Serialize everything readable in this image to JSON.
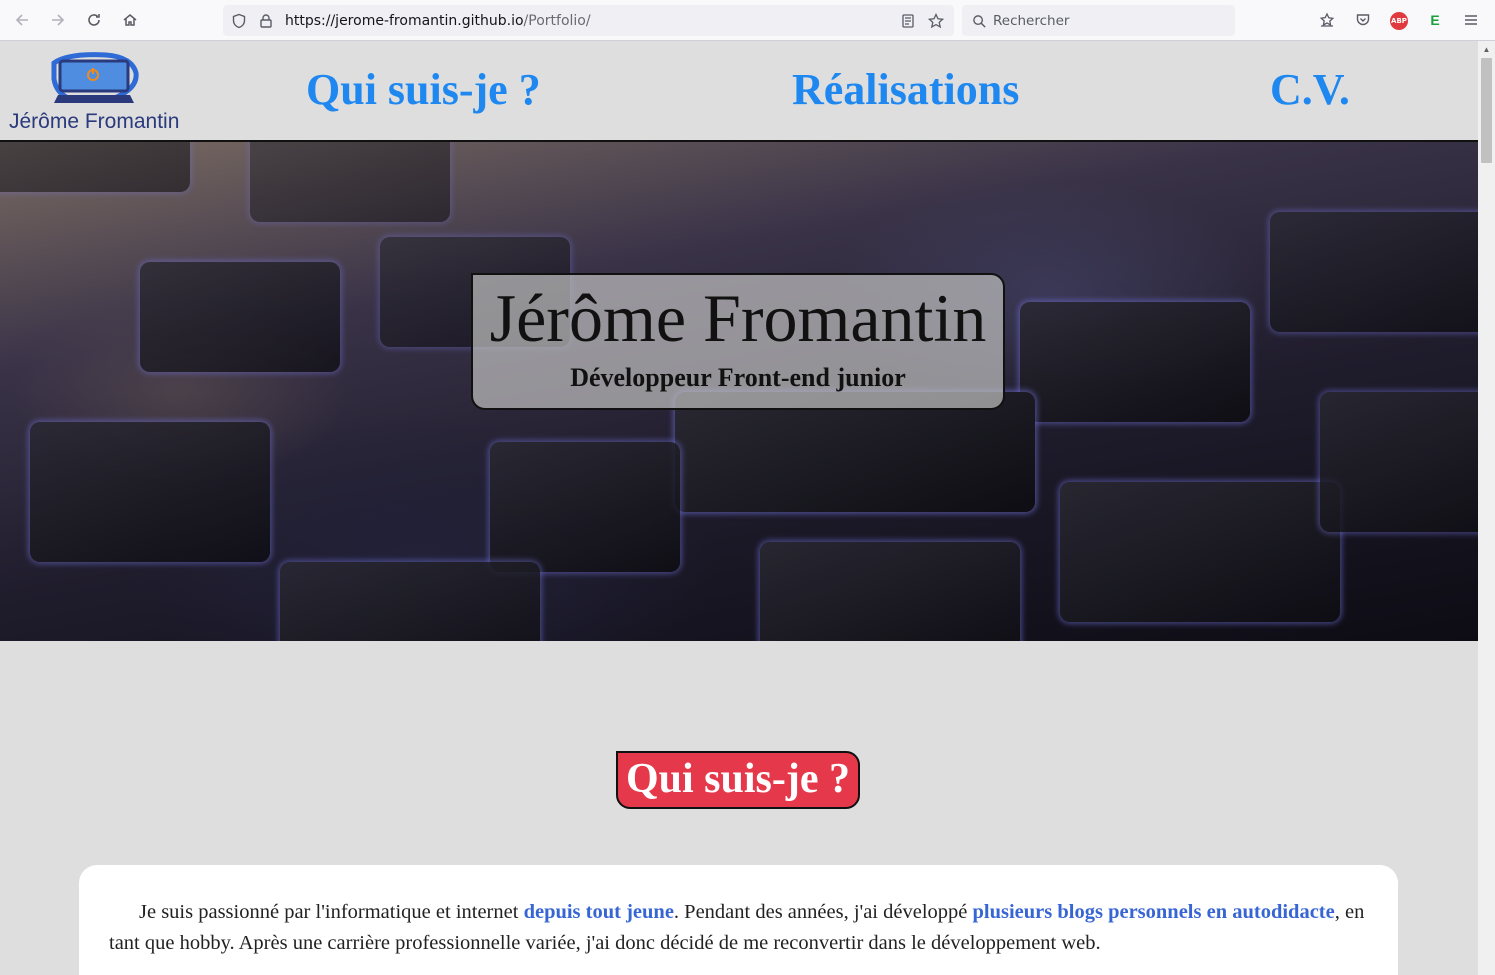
{
  "browser": {
    "url_domain": "https://jerome-fromantin.github.io",
    "url_path": "/Portfolio/",
    "search_placeholder": "Rechercher",
    "extensions": {
      "abp_label": "ABP",
      "e_label": "E"
    },
    "icons": [
      "back-arrow-icon",
      "forward-arrow-icon",
      "reload-icon",
      "home-icon",
      "shield-icon",
      "lock-icon",
      "reader-view-icon",
      "bookmark-star-icon",
      "search-icon",
      "library-icon",
      "pocket-icon",
      "menu-icon"
    ]
  },
  "site": {
    "logo_text": "Jérôme Fromantin",
    "nav": [
      {
        "label": "Qui suis-je ?"
      },
      {
        "label": "Réalisations"
      },
      {
        "label": "C.V."
      }
    ],
    "hero": {
      "title": "Jérôme Fromantin",
      "subtitle": "Développeur Front-end junior"
    },
    "section": {
      "title": "Qui suis-je ?",
      "paragraph": {
        "t1": "Je suis passionné par l'informatique et internet ",
        "h1": "depuis tout jeune",
        "t2": ". Pendant des années, j'ai développé ",
        "h2": "plusieurs blogs personnels en autodidacte",
        "t3": ", en tant que hobby. Après une carrière professionnelle variée, j'ai donc décidé de me reconvertir dans le développement web."
      }
    }
  },
  "colors": {
    "nav_link": "#1e88f0",
    "section_title_bg": "#e5394b",
    "highlight": "#3766d4",
    "page_bg": "#dedede"
  }
}
